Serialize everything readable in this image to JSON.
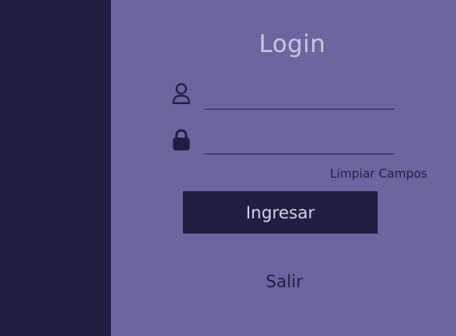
{
  "login": {
    "title": "Login",
    "username": {
      "icon": "user-icon",
      "value": "",
      "placeholder": ""
    },
    "password": {
      "icon": "lock-icon",
      "value": "",
      "placeholder": ""
    },
    "clear_label": "Limpiar Campos",
    "submit_label": "Ingresar",
    "exit_label": "Salir"
  },
  "colors": {
    "sidebar": "#1f1f45",
    "background": "#6b669f",
    "title": "#c9c7df",
    "button": "#1f1f45",
    "button_text": "#d4d2e6"
  }
}
